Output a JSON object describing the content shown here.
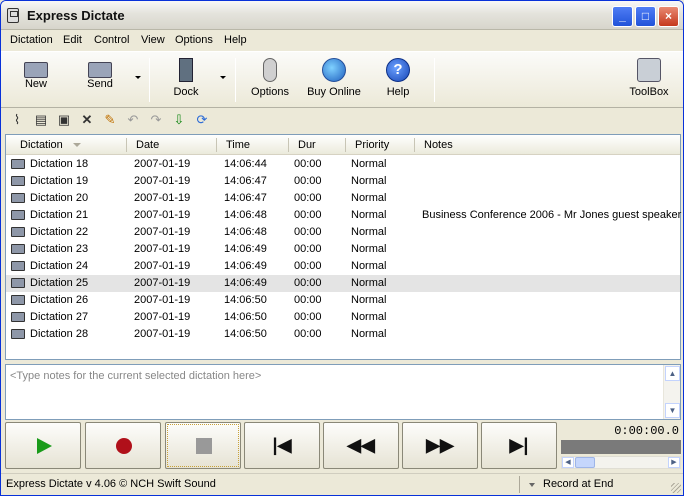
{
  "window": {
    "title": "Express Dictate"
  },
  "menu": [
    "Dictation",
    "Edit",
    "Control",
    "View",
    "Options",
    "Help"
  ],
  "toolbar": {
    "new": "New",
    "send": "Send",
    "dock": "Dock",
    "options": "Options",
    "buy_online": "Buy Online",
    "help": "Help",
    "toolbox": "ToolBox"
  },
  "list": {
    "columns": [
      "Dictation",
      "Date",
      "Time",
      "Dur",
      "Priority",
      "Notes"
    ],
    "rows": [
      {
        "name": "Dictation 18",
        "date": "2007-01-19",
        "time": "14:06:44",
        "dur": "00:00",
        "priority": "Normal",
        "notes": ""
      },
      {
        "name": "Dictation 19",
        "date": "2007-01-19",
        "time": "14:06:47",
        "dur": "00:00",
        "priority": "Normal",
        "notes": ""
      },
      {
        "name": "Dictation 20",
        "date": "2007-01-19",
        "time": "14:06:47",
        "dur": "00:00",
        "priority": "Normal",
        "notes": ""
      },
      {
        "name": "Dictation 21",
        "date": "2007-01-19",
        "time": "14:06:48",
        "dur": "00:00",
        "priority": "Normal",
        "notes": "Business Conference 2006 - Mr Jones guest speaker"
      },
      {
        "name": "Dictation 22",
        "date": "2007-01-19",
        "time": "14:06:48",
        "dur": "00:00",
        "priority": "Normal",
        "notes": ""
      },
      {
        "name": "Dictation 23",
        "date": "2007-01-19",
        "time": "14:06:49",
        "dur": "00:00",
        "priority": "Normal",
        "notes": ""
      },
      {
        "name": "Dictation 24",
        "date": "2007-01-19",
        "time": "14:06:49",
        "dur": "00:00",
        "priority": "Normal",
        "notes": ""
      },
      {
        "name": "Dictation 25",
        "date": "2007-01-19",
        "time": "14:06:49",
        "dur": "00:00",
        "priority": "Normal",
        "notes": ""
      },
      {
        "name": "Dictation 26",
        "date": "2007-01-19",
        "time": "14:06:50",
        "dur": "00:00",
        "priority": "Normal",
        "notes": ""
      },
      {
        "name": "Dictation 27",
        "date": "2007-01-19",
        "time": "14:06:50",
        "dur": "00:00",
        "priority": "Normal",
        "notes": ""
      },
      {
        "name": "Dictation 28",
        "date": "2007-01-19",
        "time": "14:06:50",
        "dur": "00:00",
        "priority": "Normal",
        "notes": ""
      }
    ],
    "selected": "Dictation 25"
  },
  "notes": {
    "placeholder": "<Type notes for the current selected dictation here>"
  },
  "transport": {
    "time": "0:00:00.0"
  },
  "status": {
    "left": "Express Dictate v 4.06 © NCH Swift Sound",
    "right": "Record at End"
  }
}
